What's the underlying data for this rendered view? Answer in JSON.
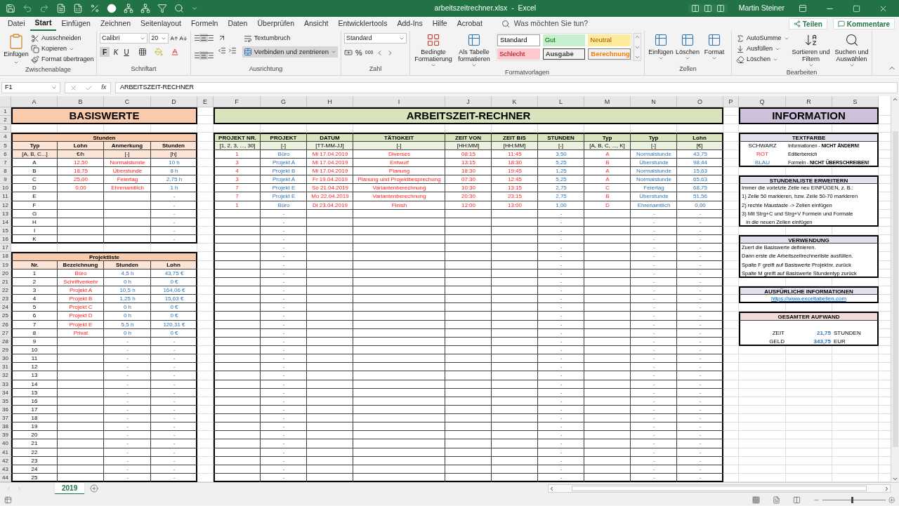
{
  "title_bar": {
    "file_name": "arbeitszeitrechner.xlsx  -  Excel",
    "user": "Martin Steiner"
  },
  "menu_tabs": [
    {
      "label": "Datei",
      "selected": false
    },
    {
      "label": "Start",
      "selected": true
    },
    {
      "label": "Einfügen",
      "selected": false
    },
    {
      "label": "Zeichnen",
      "selected": false
    },
    {
      "label": "Seitenlayout",
      "selected": false
    },
    {
      "label": "Formeln",
      "selected": false
    },
    {
      "label": "Daten",
      "selected": false
    },
    {
      "label": "Überprüfen",
      "selected": false
    },
    {
      "label": "Ansicht",
      "selected": false
    },
    {
      "label": "Entwicklertools",
      "selected": false
    },
    {
      "label": "Add-Ins",
      "selected": false
    },
    {
      "label": "Hilfe",
      "selected": false
    },
    {
      "label": "Acrobat",
      "selected": false
    }
  ],
  "tell_me": {
    "placeholder": "Was möchten Sie tun?"
  },
  "share_button": "Teilen",
  "comments_button": "Kommentare",
  "ribbon": {
    "clipboard": {
      "label": "Zwischenablage",
      "paste": "Einfügen",
      "items": [
        "Ausschneiden",
        "Kopieren",
        "Format übertragen"
      ]
    },
    "font": {
      "label": "Schriftart",
      "family": "Calibri",
      "size": "20",
      "bold": "F",
      "italic": "K",
      "underline": "U"
    },
    "alignment": {
      "label": "Ausrichtung",
      "wrap": "Textumbruch",
      "merge": "Verbinden und zentrieren"
    },
    "number": {
      "label": "Zahl",
      "format": "Standard",
      "percent": "%",
      "thousands": "000"
    },
    "styles": {
      "label": "Formatvorlagen",
      "conditional": "Bedingte Formatierung",
      "as_table": "Als Tabelle formatieren",
      "cell_styles": [
        {
          "label": "Standard",
          "kind": "standard"
        },
        {
          "label": "Gut",
          "kind": "good"
        },
        {
          "label": "Neutral",
          "kind": "neutral"
        },
        {
          "label": "Schlecht",
          "kind": "bad"
        },
        {
          "label": "Ausgabe",
          "kind": "output"
        },
        {
          "label": "Berechnung",
          "kind": "calculation"
        }
      ]
    },
    "cells": {
      "label": "Zellen",
      "buttons": [
        "Einfügen",
        "Löschen",
        "Format"
      ]
    },
    "editing": {
      "label": "Bearbeiten",
      "items": [
        "AutoSumme",
        "Ausfüllen",
        "Löschen"
      ],
      "sort": "Sortieren und Filtern",
      "find": "Suchen und Auswählen"
    }
  },
  "formula_bar": {
    "name_box": "F1",
    "function_label": "fx",
    "formula": "ARBEITSZEIT-RECHNER"
  },
  "sheet": {
    "columns": [
      "A",
      "B",
      "C",
      "D",
      "E",
      "F",
      "G",
      "H",
      "I",
      "J",
      "K",
      "L",
      "M",
      "N",
      "O",
      "P",
      "Q",
      "R",
      "S"
    ],
    "row_numbers": [
      "1",
      "2",
      "3",
      "4",
      "5",
      "6",
      "7",
      "8",
      "9",
      "10",
      "11",
      "12",
      "13",
      "14",
      "15",
      "16",
      "17",
      "18",
      "19",
      "20",
      "21",
      "22",
      "23",
      "24",
      "25",
      "26",
      "27",
      "28",
      "29",
      "30",
      "31",
      "32",
      "33",
      "34",
      "35",
      "36",
      "37",
      "38",
      "39",
      "40",
      "41",
      "42",
      "43",
      "44"
    ],
    "basiswerte": {
      "title": "BASISWERTE",
      "tables": [
        {
          "caption": "Stunden",
          "columns": [
            {
              "header": "Typ",
              "unit": "[A, B, C...]",
              "kind": "label"
            },
            {
              "header": "Lohn",
              "unit": "€/h",
              "kind": "input"
            },
            {
              "header": "Anmerkung",
              "unit": "[-]",
              "kind": "input"
            },
            {
              "header": "Stunden",
              "unit": "[h]",
              "kind": "formula"
            }
          ],
          "rows": [
            [
              "A",
              "12,50",
              "Normalstunde",
              "10 h"
            ],
            [
              "B",
              "18,75",
              "Überstunde",
              "8 h"
            ],
            [
              "C",
              "25,00",
              "Feiertag",
              "2,75 h"
            ],
            [
              "D",
              "0,00",
              "Ehrenamtlich",
              "1 h"
            ],
            [
              "E",
              null,
              null,
              "-"
            ],
            [
              "F",
              null,
              null,
              "-"
            ],
            [
              "G",
              null,
              null,
              "-"
            ],
            [
              "H",
              null,
              null,
              "-"
            ],
            [
              "I",
              null,
              null,
              "-"
            ],
            [
              "K",
              null,
              null,
              "-"
            ]
          ]
        },
        {
          "caption": "Projektliste",
          "columns": [
            {
              "header": "Nr.",
              "kind": "label"
            },
            {
              "header": "Bezeichnung",
              "kind": "input"
            },
            {
              "header": "Stunden",
              "kind": "formula"
            },
            {
              "header": "Lohn",
              "kind": "formula"
            }
          ],
          "rows": [
            [
              "1",
              "Büro",
              "4,5 h",
              "43,75 €"
            ],
            [
              "2",
              "Schriftverkehr",
              "0 h",
              "0 €"
            ],
            [
              "3",
              "Projekt A",
              "10,5 h",
              "164,06 €"
            ],
            [
              "4",
              "Projekt B",
              "1,25 h",
              "15,63 €"
            ],
            [
              "5",
              "Projekt C",
              "0 h",
              "0 €"
            ],
            [
              "6",
              "Projekt D",
              "0 h",
              "0 €"
            ],
            [
              "7",
              "Projekt E",
              "5,5 h",
              "120,31 €"
            ],
            [
              "8",
              "Privat",
              "0 h",
              "0 €"
            ],
            [
              "9",
              null,
              "-",
              "-"
            ],
            [
              "10",
              null,
              "-",
              "-"
            ],
            [
              "11",
              null,
              "-",
              "-"
            ],
            [
              "12",
              null,
              "-",
              "-"
            ],
            [
              "13",
              null,
              "-",
              "-"
            ],
            [
              "14",
              null,
              "-",
              "-"
            ],
            [
              "15",
              null,
              "-",
              "-"
            ],
            [
              "16",
              null,
              "-",
              "-"
            ],
            [
              "17",
              null,
              "-",
              "-"
            ],
            [
              "18",
              null,
              "-",
              "-"
            ],
            [
              "19",
              null,
              "-",
              "-"
            ],
            [
              "20",
              null,
              "-",
              "-"
            ],
            [
              "21",
              null,
              "-",
              "-"
            ],
            [
              "22",
              null,
              "-",
              "-"
            ],
            [
              "23",
              null,
              "-",
              "-"
            ],
            [
              "24",
              null,
              "-",
              "-"
            ],
            [
              "25",
              null,
              "-",
              "-"
            ]
          ]
        }
      ]
    },
    "rechner": {
      "title": "ARBEITSZEIT-RECHNER",
      "table": {
        "columns": [
          {
            "header": "PROJEKT NR.",
            "unit": "[1, 2, 3, ..., 30]",
            "kind": "input"
          },
          {
            "header": "PROJEKT",
            "unit": "[-]",
            "kind": "formula"
          },
          {
            "header": "DATUM",
            "unit": "[TT-MM-JJ]",
            "kind": "input"
          },
          {
            "header": "TÄTIGKEIT",
            "unit": "[-]",
            "kind": "input"
          },
          {
            "header": "ZEIT VON",
            "unit": "[HH:MM]",
            "kind": "input"
          },
          {
            "header": "ZEIT BIS",
            "unit": "[HH:MM]",
            "kind": "input"
          },
          {
            "header": "STUNDEN",
            "unit": "[-]",
            "kind": "formula"
          },
          {
            "header": "Typ",
            "unit": "[A, B, C, ..., K]",
            "kind": "input"
          },
          {
            "header": "Typ",
            "unit": "[-]",
            "kind": "formula"
          },
          {
            "header": "Lohn",
            "unit": "[€]",
            "kind": "formula"
          }
        ],
        "rows": [
          [
            "1",
            "Büro",
            "Mi 17.04.2019",
            "Diverses",
            "08:15",
            "11:45",
            "3,50",
            "A",
            "Normalstunde",
            "43,75"
          ],
          [
            "3",
            "Projekt A",
            "Mi 17.04.2019",
            "Entwurf",
            "13:15",
            "18:30",
            "5,25",
            "B",
            "Überstunde",
            "98,44"
          ],
          [
            "4",
            "Projekt B",
            "Mi 17.04.2019",
            "Planung",
            "18:30",
            "19:45",
            "1,25",
            "A",
            "Normalstunde",
            "15,63"
          ],
          [
            "3",
            "Projekt A",
            "Fr 19.04.2019",
            "Planung und Projektbesprechung",
            "07:30",
            "12:45",
            "5,25",
            "A",
            "Normalstunde",
            "65,63"
          ],
          [
            "7",
            "Projekt E",
            "So 21.04.2019",
            "Variantenberechnung",
            "10:30",
            "13:15",
            "2,75",
            "C",
            "Feiertag",
            "68,75"
          ],
          [
            "7",
            "Projekt E",
            "Mo 22.04.2019",
            "Variantenberechnung",
            "20:30",
            "23:15",
            "2,75",
            "B",
            "Überstunde",
            "51,56"
          ],
          [
            "1",
            "Büro",
            "Di 23.04.2019",
            "Finish",
            "12:00",
            "13:00",
            "1,00",
            "D",
            "Ehrenamtlich",
            "0,00"
          ],
          [
            null,
            "-",
            null,
            null,
            null,
            null,
            "-",
            null,
            "-",
            "-"
          ],
          [
            null,
            "-",
            null,
            null,
            null,
            null,
            "-",
            null,
            "-",
            "-"
          ],
          [
            null,
            "-",
            null,
            null,
            null,
            null,
            "-",
            null,
            "-",
            "-"
          ],
          [
            null,
            "-",
            null,
            null,
            null,
            null,
            "-",
            null,
            "-",
            "-"
          ],
          [
            null,
            "-",
            null,
            null,
            null,
            null,
            "-",
            null,
            "-",
            "-"
          ],
          [
            null,
            "-",
            null,
            null,
            null,
            null,
            "-",
            null,
            "-",
            "-"
          ],
          [
            null,
            "-",
            null,
            null,
            null,
            null,
            "-",
            null,
            "-",
            "-"
          ],
          [
            null,
            "-",
            null,
            null,
            null,
            null,
            "-",
            null,
            "-",
            "-"
          ],
          [
            null,
            "-",
            null,
            null,
            null,
            null,
            "-",
            null,
            "-",
            "-"
          ],
          [
            null,
            "-",
            null,
            null,
            null,
            null,
            "-",
            null,
            "-",
            "-"
          ],
          [
            null,
            "-",
            null,
            null,
            null,
            null,
            "-",
            null,
            "-",
            "-"
          ],
          [
            null,
            "-",
            null,
            null,
            null,
            null,
            "-",
            null,
            "-",
            "-"
          ],
          [
            null,
            "-",
            null,
            null,
            null,
            null,
            "-",
            null,
            "-",
            "-"
          ],
          [
            null,
            "-",
            null,
            null,
            null,
            null,
            "-",
            null,
            "-",
            "-"
          ],
          [
            null,
            "-",
            null,
            null,
            null,
            null,
            "-",
            null,
            "-",
            "-"
          ],
          [
            null,
            "-",
            null,
            null,
            null,
            null,
            "-",
            null,
            "-",
            "-"
          ],
          [
            null,
            "-",
            null,
            null,
            null,
            null,
            "-",
            null,
            "-",
            "-"
          ],
          [
            null,
            "-",
            null,
            null,
            null,
            null,
            "-",
            null,
            "-",
            "-"
          ],
          [
            null,
            "-",
            null,
            null,
            null,
            null,
            "-",
            null,
            "-",
            "-"
          ],
          [
            null,
            "-",
            null,
            null,
            null,
            null,
            "-",
            null,
            "-",
            "-"
          ],
          [
            null,
            "-",
            null,
            null,
            null,
            null,
            "-",
            null,
            "-",
            "-"
          ],
          [
            null,
            "-",
            null,
            null,
            null,
            null,
            "-",
            null,
            "-",
            "-"
          ],
          [
            null,
            "-",
            null,
            null,
            null,
            null,
            "-",
            null,
            "-",
            "-"
          ],
          [
            null,
            "-",
            null,
            null,
            null,
            null,
            "-",
            null,
            "-",
            "-"
          ],
          [
            null,
            "-",
            null,
            null,
            null,
            null,
            "-",
            null,
            "-",
            "-"
          ],
          [
            null,
            "-",
            null,
            null,
            null,
            null,
            "-",
            null,
            "-",
            "-"
          ],
          [
            null,
            "-",
            null,
            null,
            null,
            null,
            "-",
            null,
            "-",
            "-"
          ],
          [
            null,
            "-",
            null,
            null,
            null,
            null,
            "-",
            null,
            "-",
            "-"
          ],
          [
            null,
            "-",
            null,
            null,
            null,
            null,
            "-",
            null,
            "-",
            "-"
          ],
          [
            null,
            "-",
            null,
            null,
            null,
            null,
            "-",
            null,
            "-",
            "-"
          ],
          [
            null,
            "-",
            null,
            null,
            null,
            null,
            "-",
            null,
            "-",
            "-"
          ],
          [
            null,
            "-",
            null,
            null,
            null,
            null,
            "-",
            null,
            "-",
            "-"
          ]
        ]
      }
    },
    "information": {
      "title": "INFORMATION",
      "boxes": [
        {
          "kind": "legend",
          "title": "TEXTFARBE",
          "rows": [
            {
              "kind": "label",
              "name": "SCHWARZ",
              "text": "Informationen - **NICHT ÄNDERN!**"
            },
            {
              "kind": "input",
              "name": "ROT",
              "text": "Editierbereich"
            },
            {
              "kind": "formula",
              "name": "BLAU",
              "text": "Formeln - **NICHT ÜBERSCHREIBEN!**"
            }
          ]
        },
        {
          "kind": "text",
          "title": "STUNDENLISTE ERWEITERN",
          "lines": [
            "Immer die vorletzte Zeile neu EINFÜGEN, z. B.:",
            "1) Zeile 50 markieren, bzw. Zeile 50-70 markieren",
            "2) rechte Maustaste -> Zellen einfügen",
            "3) Mit Strg+C und Strg+V Formeln und Formate",
            "   in die neuen Zeilen einfügen"
          ]
        },
        {
          "kind": "text",
          "title": "VERWENDUNG",
          "lines": [
            "Zuert die Basiswerte definieren.",
            "Dann erste die Arbeitszeitrechnerliste ausfüllen.",
            "Spalte F greift auf Basiswerte Projektnr. zurück",
            "Spalte M greift auf Basiswerte Stundentyp zurück"
          ]
        },
        {
          "kind": "link",
          "title": "AUSFÜRLICHE INFORMATIONEN",
          "lines": [
            "https://www.exceltabellen.com"
          ]
        },
        {
          "kind": "totals",
          "title": "GESAMTER AUFWAND",
          "rows": [
            {
              "label": "ZEIT",
              "value": "21,75",
              "unit": "STUNDEN"
            },
            {
              "label": "GELD",
              "value": "343,75",
              "unit": "EUR"
            }
          ]
        }
      ]
    }
  },
  "sheet_tabs": [
    {
      "label": "2019",
      "selected": true
    }
  ],
  "zoom": {
    "level": 0.45
  }
}
